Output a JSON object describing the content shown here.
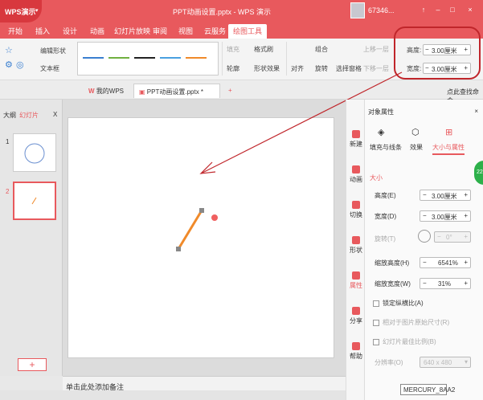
{
  "app": {
    "name": "WPS演示",
    "title": "PPT动画设置.pptx - WPS 演示",
    "user": "67346..."
  },
  "window": {
    "min": "–",
    "max": "□",
    "close": "×"
  },
  "menu": [
    "开始",
    "插入",
    "设计",
    "动画",
    "幻灯片放映",
    "审阅",
    "视图",
    "云服务",
    "绘图工具"
  ],
  "ribbon": {
    "edit_shape": "编辑形状",
    "text_box": "文本框",
    "fill": "填充",
    "format_brush": "格式刷",
    "outline": "轮廓",
    "shape_effect": "形状效果",
    "align": "对齐",
    "rotate": "旋转",
    "group": "组合",
    "select_pane": "选择窗格",
    "up_layer": "上移一层",
    "down_layer": "下移一层",
    "height_label": "高度:",
    "height_value": "3.00厘米",
    "width_label": "宽度:",
    "width_value": "3.00厘米"
  },
  "doctabs": {
    "my_wps": "我的WPS",
    "file": "PPT动画设置.pptx *",
    "add": "+",
    "search_cmd": "点此查找命令"
  },
  "slide_panel": {
    "outline": "大纲",
    "slides": "幻灯片",
    "close": "X",
    "n1": "1",
    "n2": "2",
    "add": "+"
  },
  "notes": {
    "placeholder": "单击此处添加备注"
  },
  "side_tools": [
    "新建",
    "动画",
    "切换",
    "形状",
    "属性",
    "分享",
    "帮助"
  ],
  "props": {
    "title": "对象属性",
    "tabs": [
      "填充与线条",
      "效果",
      "大小与属性"
    ],
    "section": "大小",
    "height_label": "高度(E)",
    "height_value": "3.00厘米",
    "width_label": "宽度(D)",
    "width_value": "3.00厘米",
    "rotate_label": "旋转(T)",
    "rotate_value": "0°",
    "scale_h_label": "缩放高度(H)",
    "scale_h_value": "6541%",
    "scale_w_label": "缩放宽度(W)",
    "scale_w_value": "31%",
    "lock_ratio": "锁定纵横比(A)",
    "relative_original": "相对于图片原始尺寸(R)",
    "best_scale": "幻灯片最佳比例(B)",
    "resolution_label": "分辨率(O)",
    "resolution_value": "640 x 480"
  },
  "badge": "22",
  "tooltip": "MERCURY_8AA2",
  "colors": {
    "accent": "#e8595d",
    "oval": "#c0262b",
    "line": "#f08a2a"
  }
}
